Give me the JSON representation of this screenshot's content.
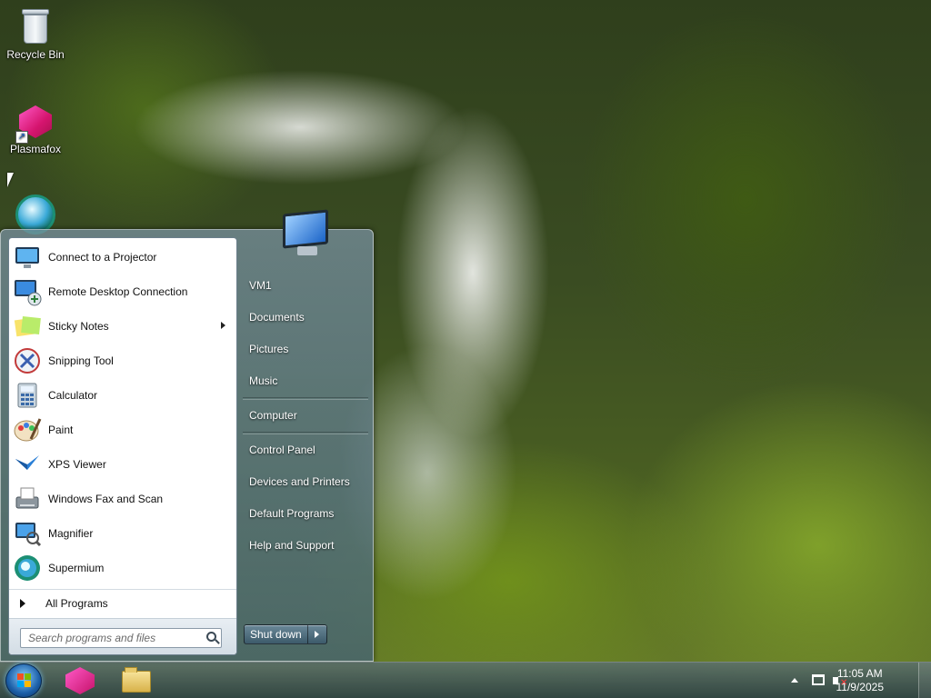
{
  "desktop": {
    "icons": [
      {
        "label": "Recycle Bin",
        "icon": "recycle-bin-icon"
      },
      {
        "label": "Plasmafox",
        "icon": "plasmafox-icon"
      },
      {
        "label": "",
        "icon": "supermium-icon"
      }
    ]
  },
  "start_menu": {
    "programs": [
      {
        "label": "Connect to a Projector",
        "icon": "projector-icon"
      },
      {
        "label": "Remote Desktop Connection",
        "icon": "remote-desktop-icon"
      },
      {
        "label": "Sticky Notes",
        "icon": "sticky-notes-icon",
        "submenu": true
      },
      {
        "label": "Snipping Tool",
        "icon": "snipping-tool-icon"
      },
      {
        "label": "Calculator",
        "icon": "calculator-icon"
      },
      {
        "label": "Paint",
        "icon": "paint-icon"
      },
      {
        "label": "XPS Viewer",
        "icon": "xps-viewer-icon"
      },
      {
        "label": "Windows Fax and Scan",
        "icon": "fax-scan-icon"
      },
      {
        "label": "Magnifier",
        "icon": "magnifier-icon"
      },
      {
        "label": "Supermium",
        "icon": "supermium-icon"
      }
    ],
    "all_programs": "All Programs",
    "search_placeholder": "Search programs and files",
    "right_items": {
      "user": "VM1",
      "documents": "Documents",
      "pictures": "Pictures",
      "music": "Music",
      "computer": "Computer",
      "control_panel": "Control Panel",
      "devices": "Devices and Printers",
      "default_programs": "Default Programs",
      "help": "Help and Support"
    },
    "shutdown": "Shut down"
  },
  "taskbar": {
    "pinned": [
      {
        "icon": "plasmafox-icon"
      },
      {
        "icon": "file-explorer-icon"
      }
    ],
    "clock": {
      "time": "11:05 AM",
      "date": "11/9/2025"
    },
    "tray_icons": [
      "show-hidden-icons-icon",
      "network-icon",
      "volume-muted-icon"
    ]
  }
}
